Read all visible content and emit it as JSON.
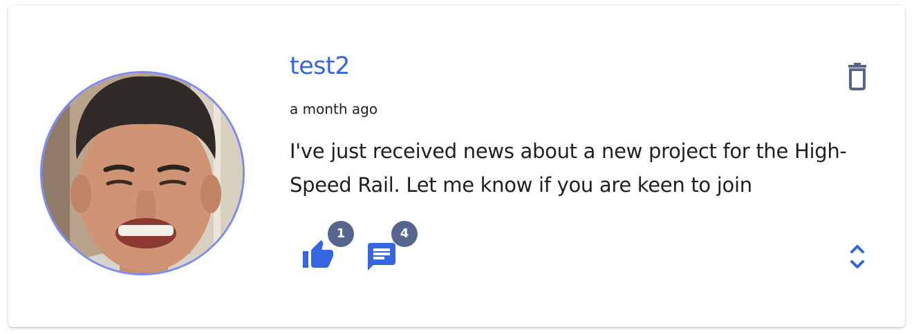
{
  "post": {
    "author": "test2",
    "timestamp": "a month ago",
    "body": "I've just received news about a new project for the High-Speed Rail. Let me know if you are keen to join",
    "likes": "1",
    "comments": "4"
  },
  "icons": {
    "delete": "trash-icon",
    "like": "thumb-up-icon",
    "comment": "comment-icon",
    "expand": "unfold-more-icon"
  },
  "colors": {
    "accent": "#3466e0",
    "badge": "#55658d",
    "icon_muted": "#55658d",
    "avatar_border": "#7c8cf2"
  }
}
